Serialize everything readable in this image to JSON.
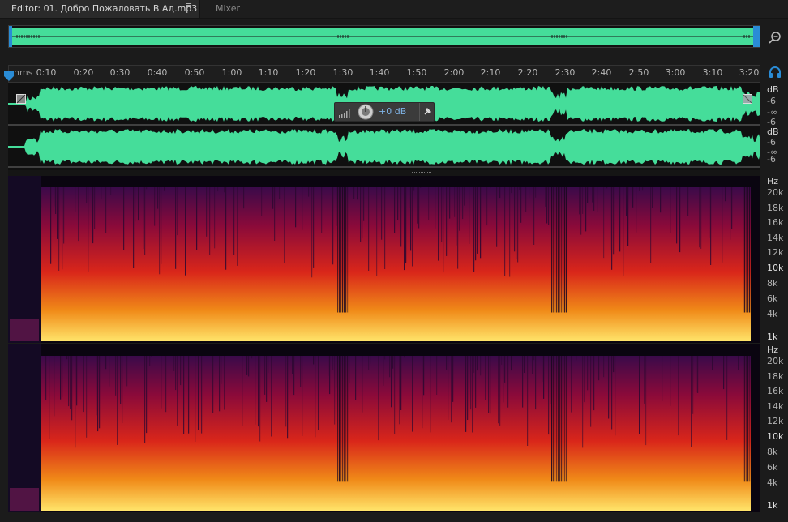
{
  "tabs": {
    "editor_label": "Editor: 01. Добро Пожаловать В Ад.mp3",
    "menu_glyph": "≡",
    "mixer_label": "Mixer"
  },
  "ruler": {
    "unit": "hms",
    "ticks": [
      "0:10",
      "0:20",
      "0:30",
      "0:40",
      "0:50",
      "1:00",
      "1:10",
      "1:20",
      "1:30",
      "1:40",
      "1:50",
      "2:00",
      "2:10",
      "2:20",
      "2:30",
      "2:40",
      "2:50",
      "3:00",
      "3:10",
      "3:20"
    ]
  },
  "hud": {
    "volume": "+0 dB"
  },
  "db_scale": {
    "channel1": {
      "unit": "dB",
      "top": "-6",
      "mid": "-∞",
      "bottom": "-6"
    },
    "channel2": {
      "unit": "dB",
      "top": "-6",
      "mid": "-∞",
      "bottom": "-6"
    }
  },
  "hz_scale": {
    "unit": "Hz",
    "labels": [
      "20k",
      "18k",
      "16k",
      "14k",
      "12k",
      "10k",
      "8k",
      "6k",
      "4k",
      "1k"
    ]
  },
  "colors": {
    "waveform": "#45dd9a",
    "accent": "#2a8cd6"
  },
  "icons": {
    "zoom": "zoom-out-magnifier-icon",
    "headphones": "headphones-icon",
    "pin": "pin-icon",
    "knob": "volume-knob-icon"
  }
}
